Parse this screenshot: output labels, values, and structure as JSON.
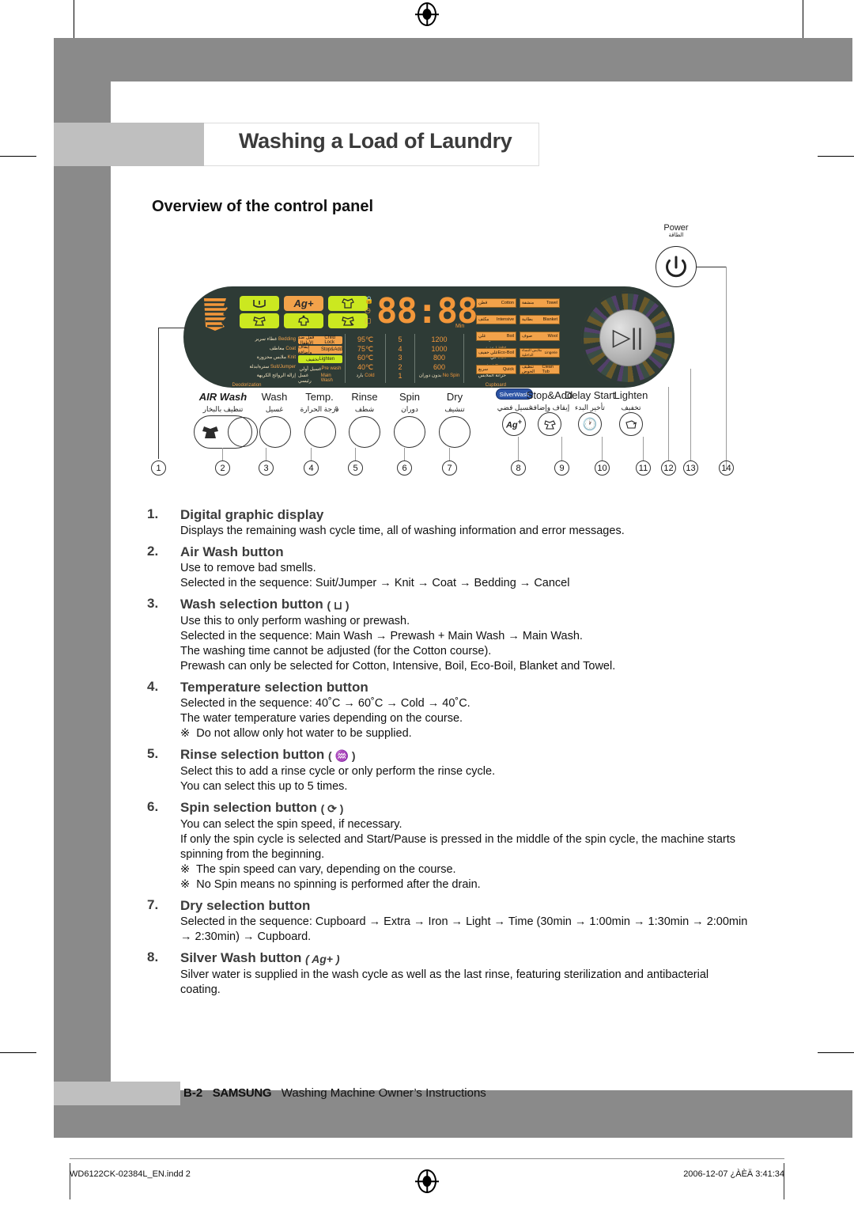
{
  "document": {
    "chapter_title": "Washing a Load of Laundry",
    "section_title": "Overview of the control panel"
  },
  "power": {
    "label": "Power",
    "label_ar": "الطاقة",
    "icon": "power-icon"
  },
  "panel": {
    "lcd_value": "88:88",
    "lcd_unit": "Min",
    "indicator_icons": [
      "lock-icon",
      "clock-icon",
      "no-iron-icon"
    ],
    "status_pills_top": [
      {
        "icon": "wash-basin-icon",
        "color": "green"
      },
      {
        "label": "Ag+",
        "color": "orange"
      },
      {
        "icon": "rinse-shirt-icon",
        "color": "green"
      }
    ],
    "status_pills_bottom": [
      {
        "icon": "prewash-icon",
        "color": "green"
      },
      {
        "icon": "wash-icon",
        "color": "green"
      },
      {
        "icon": "spin-icon",
        "color": "green"
      }
    ],
    "air_wash_options": [
      {
        "en": "Bedding",
        "ar": "غطاء سرير"
      },
      {
        "en": "Coat",
        "ar": "معاطف"
      },
      {
        "en": "Knit",
        "ar": "ملابس محزوزة"
      },
      {
        "en": "Suit/Jumper",
        "ar": "سترة/بدلة"
      },
      {
        "en": "Deodorization",
        "ar": "إزالة الروائح الكريهة"
      }
    ],
    "option_pills": [
      {
        "en": "Child Lock",
        "ar": "قفل ضد الأطفال",
        "color": "orange"
      },
      {
        "en": "Stop&Add",
        "ar": "إيقاف وإضافة",
        "color": "orange"
      },
      {
        "en": "Lighten",
        "ar": "تخفيف",
        "color": "green"
      },
      {
        "en": "Pre wash",
        "ar": "غسيل أولي",
        "color": "none"
      },
      {
        "en": "Main Wash",
        "ar": "غسل رئيسي",
        "color": "none"
      }
    ],
    "temperature_values": [
      "95℃",
      "75℃",
      "60℃",
      "40℃",
      "Cold"
    ],
    "temperature_value_ar": "بارد",
    "rinse_values": [
      "5",
      "4",
      "3",
      "2",
      "1"
    ],
    "spin_values": [
      "1200",
      "1000",
      "800",
      "600",
      "No Spin"
    ],
    "spin_value_ar": "بدون دوران",
    "dry_values": [
      {
        "en": "Time",
        "ar": "الوقت"
      },
      {
        "en": "Light",
        "ar": "خفيف"
      },
      {
        "en": "Iron",
        "ar": "كي"
      },
      {
        "en": "Extra",
        "ar": "إضافي"
      },
      {
        "en": "Cupboard",
        "ar": "خزانة الملابس"
      }
    ],
    "courses_left": [
      {
        "en": "Cotton",
        "ar": "قطن"
      },
      {
        "en": "Intensive",
        "ar": "مكثف"
      },
      {
        "en": "Boil",
        "ar": "غلي"
      },
      {
        "en": "Eco-Boil",
        "ar": "غلي خفيف"
      },
      {
        "en": "Quick",
        "ar": "سريع"
      }
    ],
    "courses_right": [
      {
        "en": "Towel",
        "ar": "منشفة"
      },
      {
        "en": "Blanket",
        "ar": "بطانية"
      },
      {
        "en": "Wool",
        "ar": "صوف"
      },
      {
        "en": "Lingerie",
        "ar": "ملابس النساء الداخلية"
      },
      {
        "en": "Clean Tub",
        "ar": "تنظيف الحوض"
      }
    ],
    "start_pause_icon": "start-pause-icon"
  },
  "buttons": [
    {
      "en": "AIR Wash",
      "ar": "تنظيف بالبخار",
      "callout": "2"
    },
    {
      "en": "Wash",
      "ar": "غسيل",
      "callout": "3"
    },
    {
      "en": "Temp.",
      "ar": "درجة الحرارة",
      "callout": "4"
    },
    {
      "en": "Rinse",
      "ar": "شطف",
      "callout": "5"
    },
    {
      "en": "Spin",
      "ar": "دوران",
      "callout": "6"
    },
    {
      "en": "Dry",
      "ar": "تنشيف",
      "callout": "7"
    },
    {
      "en": "Silver Wash",
      "ar": "غسيل فضي",
      "callout": "8"
    },
    {
      "en": "Stop&Add",
      "ar": "إيقاف وإضافة",
      "callout": "9"
    },
    {
      "en": "Delay Start",
      "ar": "تأخير البدء",
      "callout": "10"
    },
    {
      "en": "Lighten",
      "ar": "تخفيف",
      "callout": "11"
    }
  ],
  "callouts": [
    "1",
    "2",
    "3",
    "4",
    "5",
    "6",
    "7",
    "8",
    "9",
    "10",
    "11",
    "12",
    "13",
    "14"
  ],
  "silver_wash_badge": "SilverWash",
  "instructions": [
    {
      "num": "1.",
      "head": "Digital graphic display",
      "head_glyph": "",
      "lines": [
        "Displays the remaining wash cycle time, all of washing information and error messages."
      ],
      "stars": []
    },
    {
      "num": "2.",
      "head": "Air Wash button",
      "head_glyph": "",
      "lines": [
        "Use to remove bad smells.",
        "Selected in the sequence: Suit/Jumper → Knit → Coat → Bedding → Cancel"
      ],
      "stars": []
    },
    {
      "num": "3.",
      "head": "Wash selection button",
      "head_glyph": "( ⊔ )",
      "lines": [
        "Use this to only perform washing or prewash.",
        "Selected in the sequence: Main Wash → Prewash + Main Wash → Main Wash.",
        "The washing time cannot be adjusted (for the Cotton course).",
        "Prewash can only be selected for Cotton, Intensive, Boil, Eco-Boil, Blanket and Towel."
      ],
      "stars": []
    },
    {
      "num": "4.",
      "head": "Temperature selection button",
      "head_glyph": "",
      "lines": [
        "Selected in the sequence: 40˚C → 60˚C → Cold → 40˚C.",
        "The water temperature varies depending on the course."
      ],
      "stars": [
        "Do not allow only hot water to be supplied."
      ]
    },
    {
      "num": "5.",
      "head": "Rinse selection button",
      "head_glyph": "( ♒ )",
      "lines": [
        "Select this to add a rinse cycle or only perform the rinse cycle.",
        "You can select this up to 5 times."
      ],
      "stars": []
    },
    {
      "num": "6.",
      "head": "Spin selection button",
      "head_glyph": "( ⟳ )",
      "lines": [
        "You can select the spin speed, if necessary.",
        "If only the spin cycle is selected and Start/Pause is pressed in the middle of the spin cycle, the machine starts spinning from the beginning."
      ],
      "stars": [
        "The spin speed can vary, depending on the course.",
        "No Spin means no spinning is performed after the drain."
      ]
    },
    {
      "num": "7.",
      "head": "Dry selection button",
      "head_glyph": "",
      "lines": [
        "Selected in the sequence: Cupboard → Extra → Iron → Light → Time (30min → 1:00min → 1:30min → 2:00min → 2:30min) → Cupboard."
      ],
      "stars": []
    },
    {
      "num": "8.",
      "head": "Silver Wash button",
      "head_glyph": "( Ag+ )",
      "lines": [
        "Silver water is supplied in the wash cycle as well as the last rinse, featuring sterilization and antibacterial coating."
      ],
      "stars": []
    }
  ],
  "footer": {
    "page": "B-2",
    "brand": "SAMSUNG",
    "text": "Washing Machine Owner’s Instructions"
  },
  "print_marks": {
    "file": "WD6122CK-02384L_EN.indd   2",
    "timestamp": "2006-12-07   ¿ÀÈÄ 3:41:34"
  }
}
